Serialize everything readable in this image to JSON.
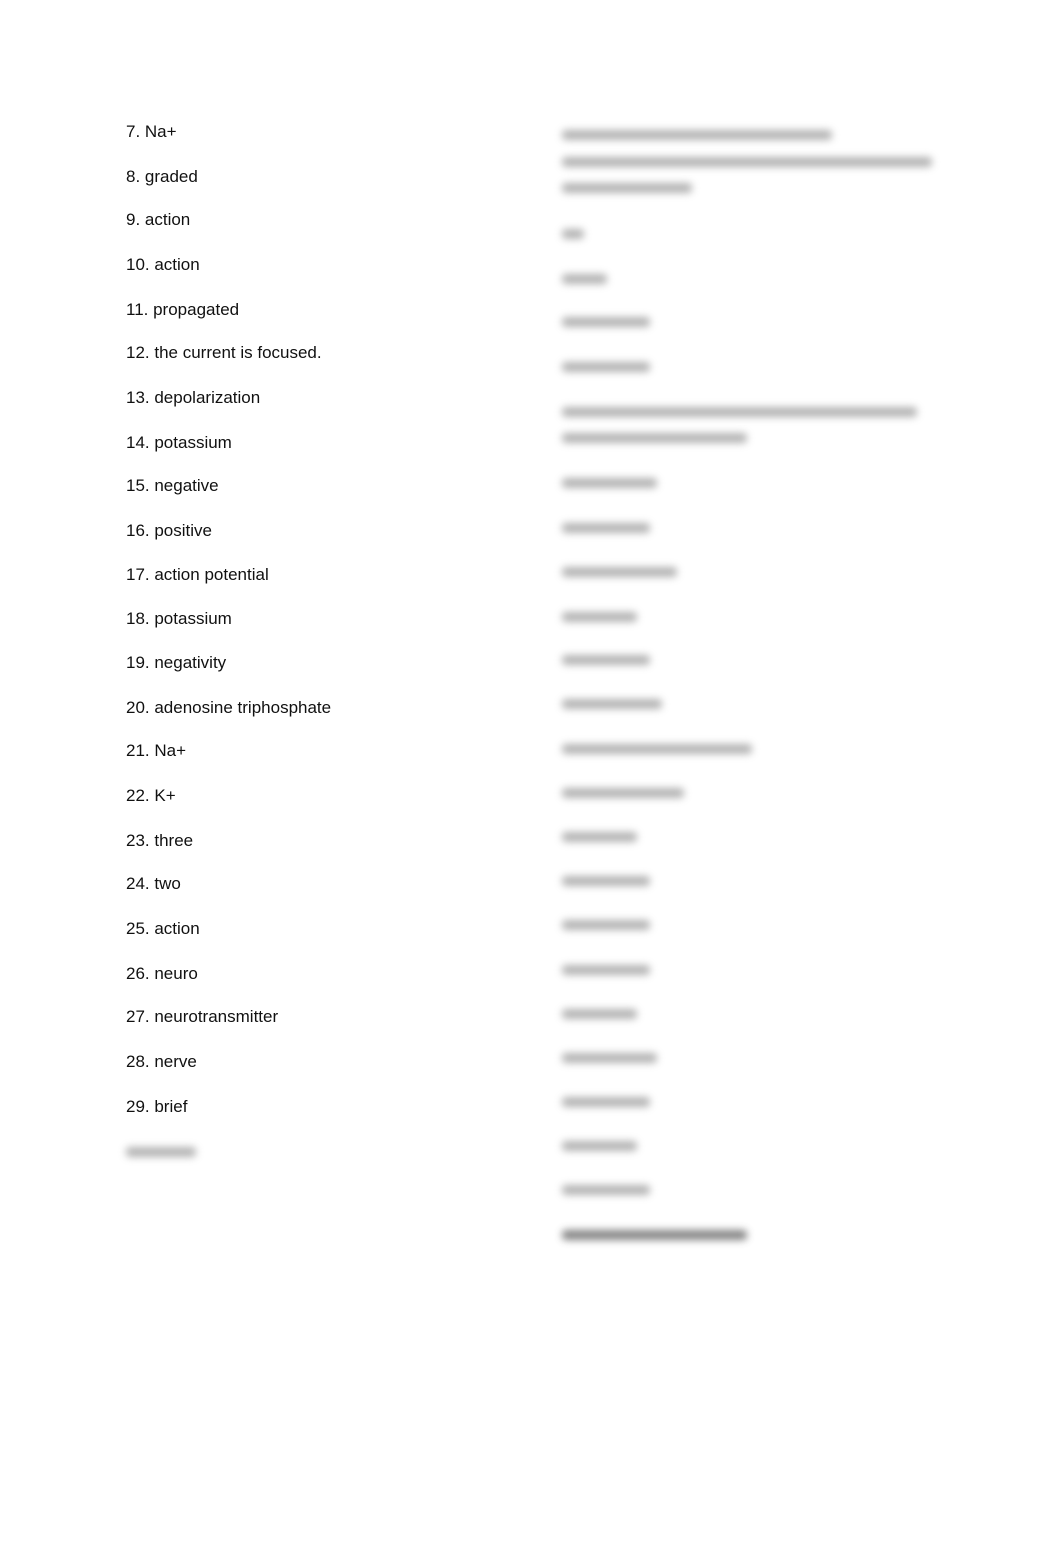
{
  "document": {
    "left_answers": [
      {
        "num": "7.",
        "text": "Na+"
      },
      {
        "num": "8.",
        "text": "graded"
      },
      {
        "num": "9.",
        "text": "action"
      },
      {
        "num": "10.",
        "text": "action"
      },
      {
        "num": "11.",
        "text": "propagated"
      },
      {
        "num": "12.",
        "text": "the current is focused."
      },
      {
        "num": "13.",
        "text": "depolarization"
      },
      {
        "num": "14.",
        "text": "potassium"
      },
      {
        "num": "15.",
        "text": "negative"
      },
      {
        "num": "16.",
        "text": "positive"
      },
      {
        "num": "17.",
        "text": "action potential"
      },
      {
        "num": "18.",
        "text": "potassium"
      },
      {
        "num": "19.",
        "text": "negativity"
      },
      {
        "num": "20.",
        "text": "adenosine triphosphate"
      },
      {
        "num": "21.",
        "text": "Na+"
      },
      {
        "num": "22.",
        "text": "K+"
      },
      {
        "num": "23.",
        "text": "three"
      },
      {
        "num": "24.",
        "text": "two"
      },
      {
        "num": "25.",
        "text": "action"
      },
      {
        "num": "26.",
        "text": "neuro"
      },
      {
        "num": "27.",
        "text": "neurotransmitter"
      },
      {
        "num": "28.",
        "text": "nerve"
      },
      {
        "num": "29.",
        "text": "brief"
      }
    ],
    "blurred_note": "Remaining answers are obscured (blurred) in the screenshot"
  }
}
